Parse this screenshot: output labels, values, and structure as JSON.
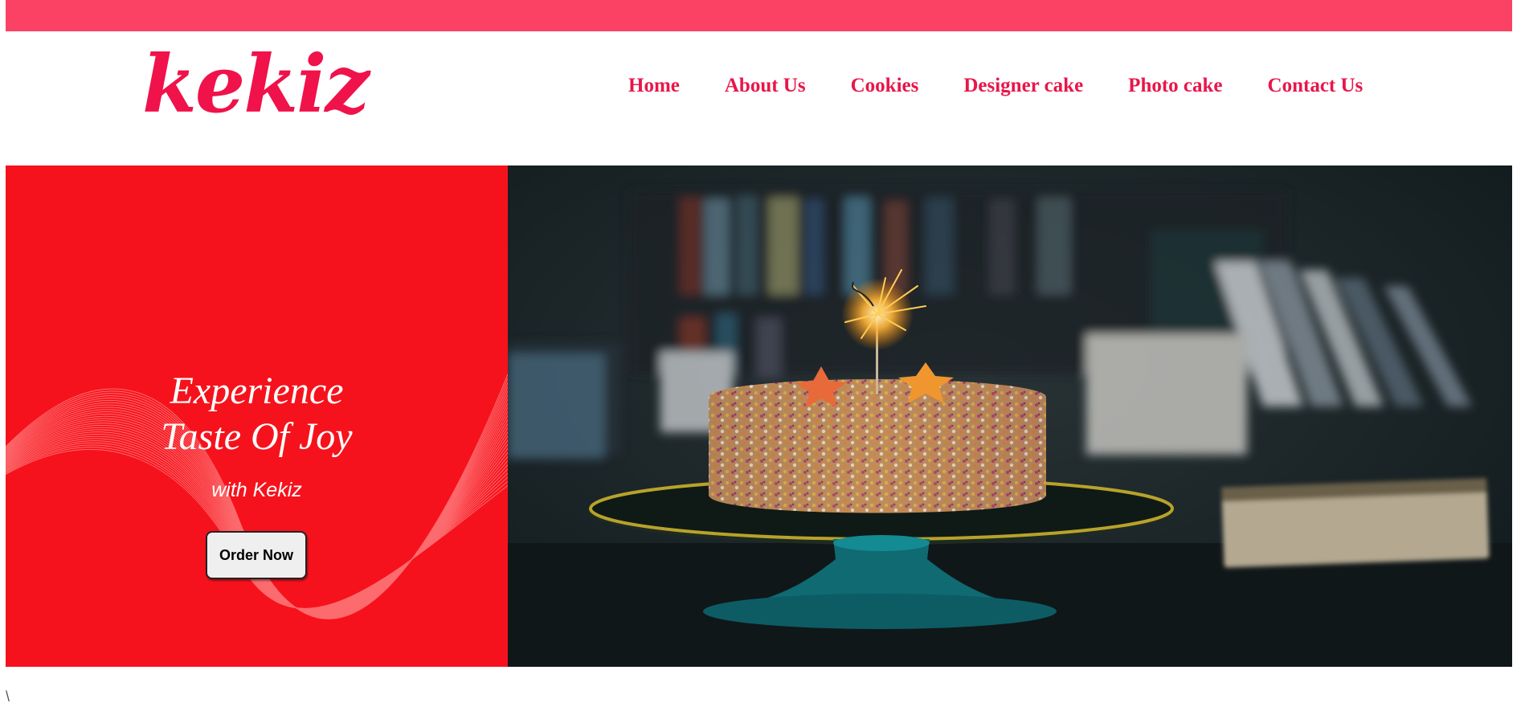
{
  "brand": {
    "logo_text": "kekiz",
    "accent": "#f0124a",
    "top_bar_color": "#fb4264"
  },
  "nav": {
    "items": [
      {
        "label": "Home"
      },
      {
        "label": "About Us"
      },
      {
        "label": "Cookies"
      },
      {
        "label": "Designer cake"
      },
      {
        "label": "Photo cake"
      },
      {
        "label": "Contact Us"
      }
    ]
  },
  "hero": {
    "title_line1": "Experience",
    "title_line2": "Taste Of Joy",
    "subtitle": "with Kekiz",
    "cta_label": "Order Now",
    "panel_color": "#f6121c",
    "image_icon": "birthday-cake-with-sparkler-photo"
  },
  "footer": {
    "stray_text": "\\"
  }
}
